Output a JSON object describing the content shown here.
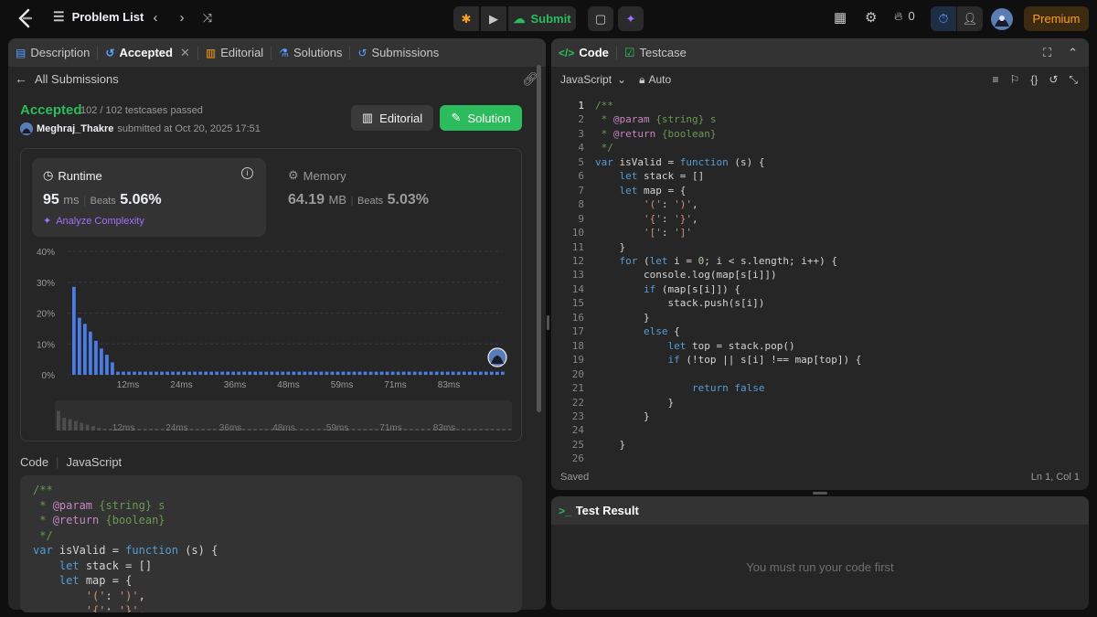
{
  "topbar": {
    "problem_list": "Problem List",
    "submit": "Submit",
    "streak_count": "0",
    "premium": "Premium"
  },
  "left_tabs": [
    {
      "label": "Description",
      "icon": "description-icon"
    },
    {
      "label": "Accepted",
      "icon": "history-icon"
    },
    {
      "label": "Editorial",
      "icon": "book-icon"
    },
    {
      "label": "Solutions",
      "icon": "flask-icon"
    },
    {
      "label": "Submissions",
      "icon": "history-icon"
    }
  ],
  "submission": {
    "back_label": "All Submissions",
    "status": "Accepted",
    "testcases": "102 / 102 testcases passed",
    "user": "Meghraj_Thakre",
    "submitted_text": "submitted at Oct 20, 2025 17:51",
    "editorial_button": "Editorial",
    "solution_button": "Solution"
  },
  "runtime": {
    "label": "Runtime",
    "value": "95",
    "unit": "ms",
    "beats_label": "Beats",
    "beats_value": "5.06%",
    "analyze": "Analyze Complexity"
  },
  "memory": {
    "label": "Memory",
    "value": "64.19",
    "unit": "MB",
    "beats_label": "Beats",
    "beats_value": "5.03%"
  },
  "chart_data": {
    "type": "bar",
    "y_ticks": [
      "40%",
      "30%",
      "20%",
      "10%",
      "0%"
    ],
    "ylim": [
      0,
      40
    ],
    "x_ticks": [
      "12ms",
      "24ms",
      "36ms",
      "48ms",
      "59ms",
      "71ms",
      "83ms"
    ],
    "values": [
      28.5,
      18.5,
      16.5,
      14,
      11,
      8.5,
      6.5,
      4,
      1,
      1,
      1,
      1,
      1,
      1,
      1,
      1,
      1,
      1,
      1,
      1,
      1,
      1,
      1,
      1,
      1,
      1,
      1,
      1,
      1,
      1,
      1,
      1,
      1,
      1,
      1,
      1,
      1,
      1,
      1,
      1,
      1,
      1,
      1,
      1,
      1,
      1,
      1,
      1,
      1,
      1,
      1,
      1,
      1,
      1,
      1,
      1,
      1,
      1,
      1,
      1,
      1,
      1,
      1,
      1,
      1,
      1,
      1,
      1,
      1,
      1,
      1,
      1,
      1,
      1,
      1,
      1,
      1,
      1,
      1
    ],
    "bar_color": "#4a7de6"
  },
  "code_section": {
    "label": "Code",
    "language": "JavaScript"
  },
  "right": {
    "tab_code": "Code",
    "tab_testcase": "Testcase",
    "language": "JavaScript",
    "auto": "Auto",
    "saved": "Saved",
    "position": "Ln 1, Col 1",
    "test_result": "Test Result",
    "run_prompt": "You must run your code first"
  },
  "code_lines": [
    "/**",
    " * @param {string} s",
    " * @return {boolean}",
    " */",
    "var isValid = function (s) {",
    "    let stack = []",
    "    let map = {",
    "        '(': ')',",
    "        '{': '}',",
    "        '[': ']'",
    "    }",
    "    for (let i = 0; i < s.length; i++) {",
    "        console.log(map[s[i]])",
    "        if (map[s[i]]) {",
    "            stack.push(s[i])",
    "        }",
    "        else {",
    "            let top = stack.pop()",
    "            if (!top || s[i] !== map[top]) {",
    "",
    "                return false",
    "            }",
    "        }",
    "",
    "    }",
    ""
  ],
  "line_numbers": [
    "1",
    "2",
    "3",
    "4",
    "5",
    "6",
    "7",
    "8",
    "9",
    "10",
    "11",
    "12",
    "13",
    "14",
    "15",
    "16",
    "17",
    "18",
    "19",
    "20",
    "21",
    "22",
    "23",
    "24",
    "25",
    "26"
  ]
}
